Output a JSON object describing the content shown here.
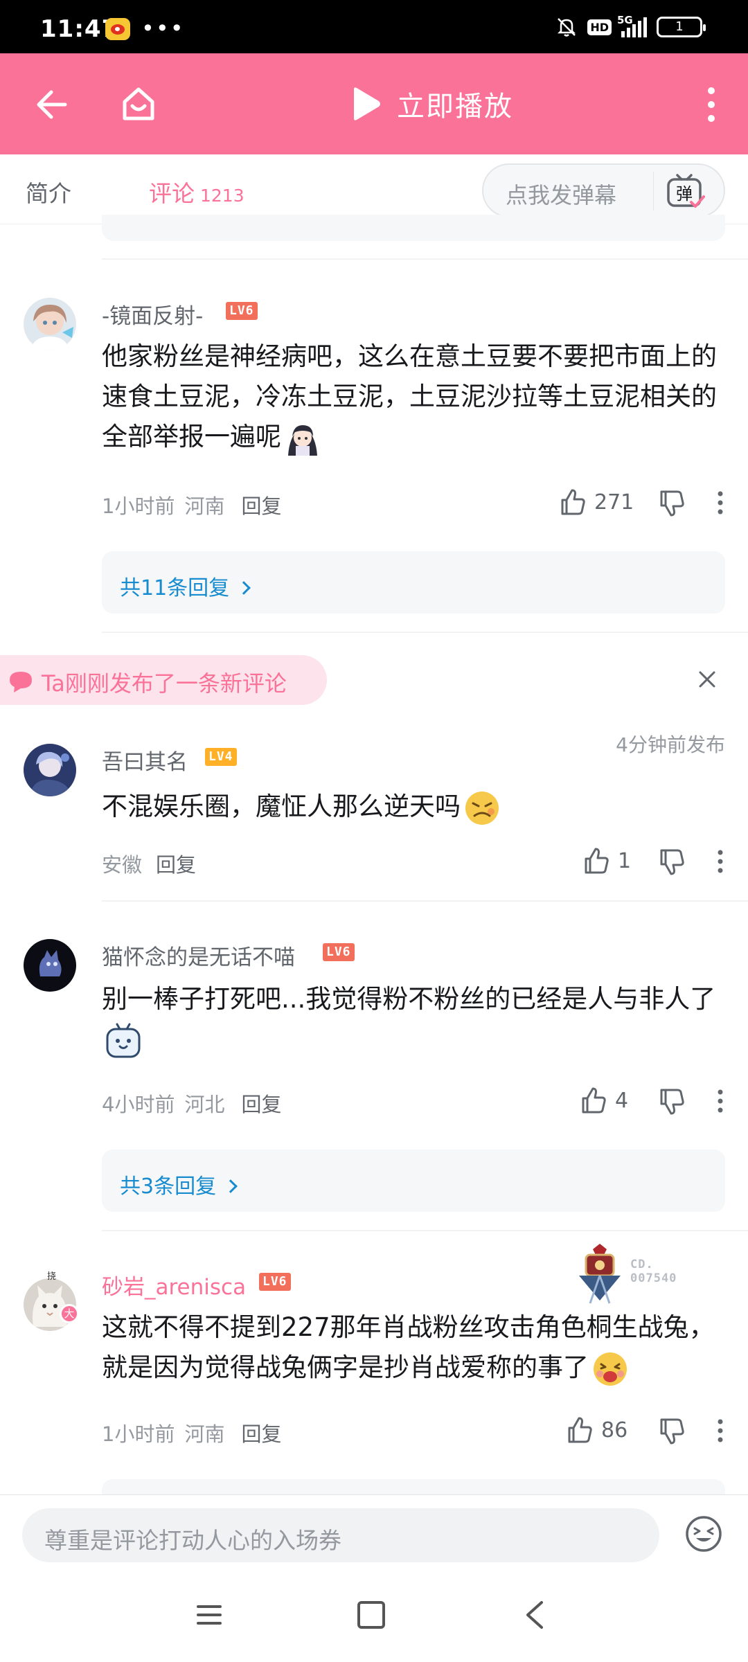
{
  "status_bar": {
    "time": "11:47",
    "dots": "•••",
    "hd": "HD",
    "network": "5G",
    "battery": "1"
  },
  "top_bar": {
    "play_label": "立即播放",
    "colors": {
      "accent": "#fb7299"
    }
  },
  "tabs": {
    "intro": "简介",
    "comments": "评论",
    "comment_count": "1213"
  },
  "danmaku": {
    "placeholder": "点我发弹幕",
    "icon_char": "弹"
  },
  "notice": {
    "text": "Ta刚刚发布了一条新评论"
  },
  "comments": [
    {
      "username": "-镜面反射-",
      "level": "LV6",
      "text": "他家粉丝是神经病吧，这么在意土豆要不要把市面上的速食土豆泥，冷冻土豆泥，土豆泥沙拉等土豆泥相关的全部举报一遍呢",
      "time": "1小时前",
      "location": "河南",
      "reply_label": "回复",
      "likes": "271",
      "replies": "共11条回复"
    },
    {
      "username": "吾曰其名",
      "level": "LV4",
      "published": "4分钟前发布",
      "text": "不混娱乐圈，魔怔人那么逆天吗",
      "location": "安徽",
      "reply_label": "回复",
      "likes": "1"
    },
    {
      "username": "猫怀念的是无话不喵",
      "level": "LV6",
      "text": "别一棒子打死吧...我觉得粉不粉丝的已经是人与非人了",
      "time": "4小时前",
      "location": "河北",
      "reply_label": "回复",
      "likes": "4",
      "replies": "共3条回复"
    },
    {
      "username": "砂岩_arenisca",
      "level": "LV6",
      "avatar_badge": "大",
      "avatar_tag": "挠",
      "medal_id_line1": "CD.",
      "medal_id_line2": "007540",
      "text": "这就不得不提到227那年肖战粉丝攻击角色桐生战兔，就是因为觉得战兔俩字是抄肖战爱称的事了",
      "time": "1小时前",
      "location": "河南",
      "reply_label": "回复",
      "likes": "86"
    }
  ],
  "bottom_input": {
    "placeholder": "尊重是评论打动人心的入场券"
  }
}
